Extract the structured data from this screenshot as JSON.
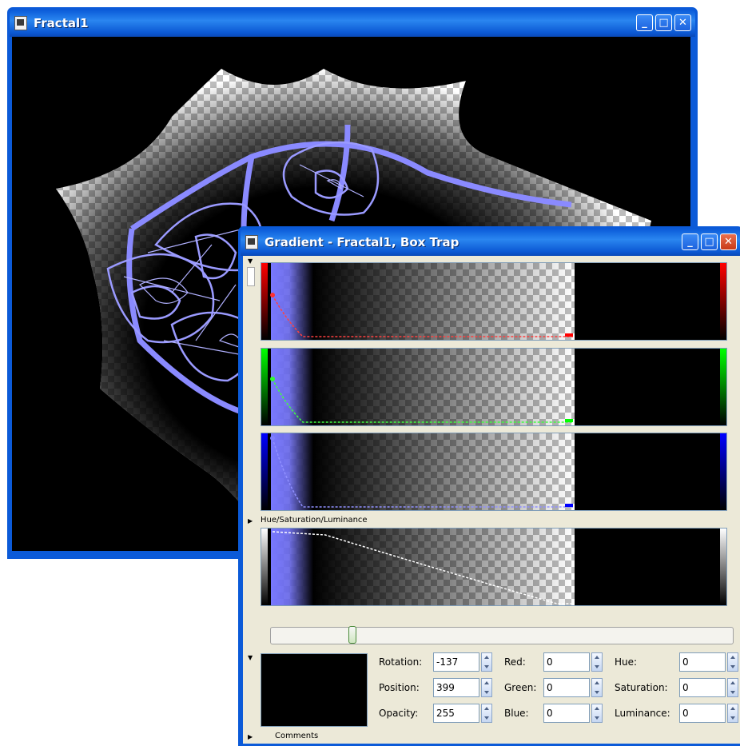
{
  "fractal_window": {
    "title": "Fractal1",
    "accent": "#7b7bff"
  },
  "gradient_window": {
    "title": "Gradient - Fractal1, Box Trap",
    "channels": [
      {
        "name": "red",
        "color": "#ff0000"
      },
      {
        "name": "green",
        "color": "#00ff00"
      },
      {
        "name": "blue",
        "color": "#0000ff"
      }
    ],
    "hsl_section_label": "Hue/Saturation/Luminance",
    "comments_label": "Comments",
    "slider_position": 0.17,
    "fields": {
      "rotation": {
        "label": "Rotation:",
        "value": "-137"
      },
      "position": {
        "label": "Position:",
        "value": "399"
      },
      "opacity": {
        "label": "Opacity:",
        "value": "255"
      },
      "red": {
        "label": "Red:",
        "value": "0"
      },
      "green": {
        "label": "Green:",
        "value": "0"
      },
      "blue": {
        "label": "Blue:",
        "value": "0"
      },
      "hue": {
        "label": "Hue:",
        "value": "0"
      },
      "saturation": {
        "label": "Saturation:",
        "value": "0"
      },
      "luminance": {
        "label": "Luminance:",
        "value": "0"
      }
    },
    "gradient_colors": {
      "start": "#7878ff",
      "mid": "#000000"
    }
  }
}
